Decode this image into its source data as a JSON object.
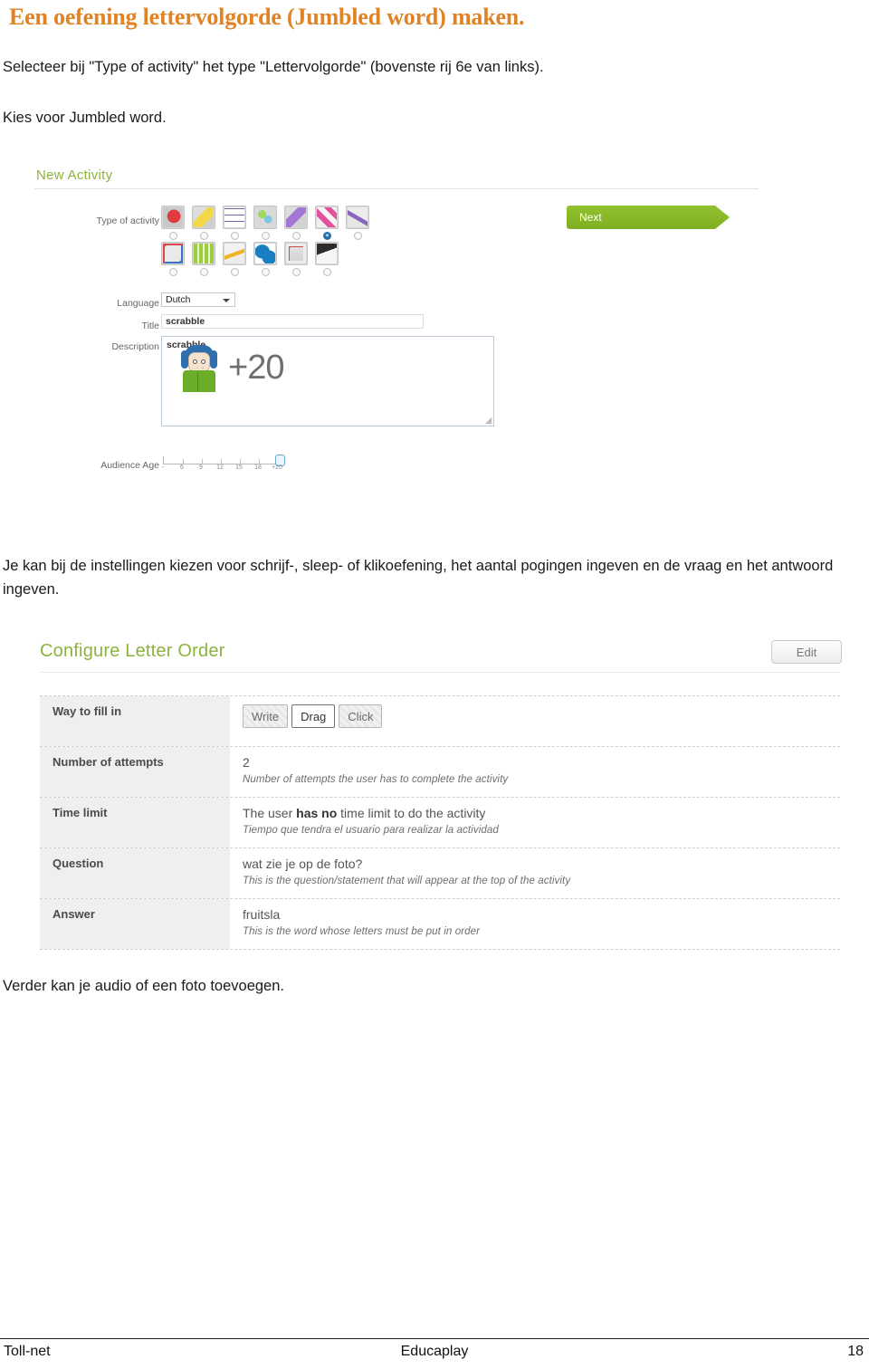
{
  "document": {
    "title": "Een oefening lettervolgorde (Jumbled word) maken.",
    "paragraph_1": "Selecteer bij \"Type of activity\" het type \"Lettervolgorde\" (bovenste rij 6e van links).",
    "paragraph_2": "Kies voor Jumbled word.",
    "paragraph_3": "Je kan bij de instellingen kiezen voor schrijf-, sleep- of klikoefening, het aantal pogingen ingeven en de vraag en het antwoord ingeven.",
    "paragraph_4": "Verder kan je audio of een foto toevoegen.",
    "heading_color": "#E08324"
  },
  "screenshot_new_activity": {
    "panel_title": "New Activity",
    "panel_title_color": "#8cb43c",
    "next_button": "Next",
    "next_button_color": "#8cc22e",
    "labels": {
      "type_of_activity": "Type of activity",
      "language": "Language",
      "title": "Title",
      "description": "Description",
      "audience_age": "Audience Age"
    },
    "activity_icons_row1": [
      {
        "name": "question-icon",
        "colors": [
          "#c9c9c9",
          "#d8262b"
        ]
      },
      {
        "name": "yellow-ruler-icon",
        "colors": [
          "#d6d6d6",
          "#efd23a"
        ]
      },
      {
        "name": "crossword-grid-icon",
        "colors": [
          "#efefef",
          "#7b5fb0"
        ]
      },
      {
        "name": "green-pins-icon",
        "colors": [
          "#d9d9d9",
          "#8fd14f"
        ]
      },
      {
        "name": "purple-feather-icon",
        "colors": [
          "#dcdcdc",
          "#9a6fd1"
        ]
      },
      {
        "name": "pink-letter-tiles-icon",
        "colors": [
          "#ececec",
          "#e3509e"
        ]
      },
      {
        "name": "word-search-icon",
        "colors": [
          "#e3e3e3",
          "#8a66c0"
        ]
      }
    ],
    "activity_icons_row2": [
      {
        "name": "matching-letters-icon",
        "colors": [
          "#dedede",
          "#d94b4b"
        ]
      },
      {
        "name": "green-keyboard-icon",
        "colors": [
          "#d7d7d7",
          "#9bcf3c"
        ]
      },
      {
        "name": "fill-in-blanks-icon",
        "colors": [
          "#e8e8e8",
          "#f0b429"
        ]
      },
      {
        "name": "world-map-icon",
        "colors": [
          "#ffffff",
          "#1a7fc1"
        ]
      },
      {
        "name": "slideshow-icon",
        "colors": [
          "#dcdcdc",
          "#c7504a"
        ]
      },
      {
        "name": "video-clapper-icon",
        "colors": [
          "#e0e0e0",
          "#2c2c2c"
        ]
      }
    ],
    "selected_icon_index": 5,
    "selected_icon_row": 1,
    "language_value": "Dutch",
    "title_value": "scrabble",
    "description_value": "scrabble",
    "age_ticks": [
      "-",
      "6",
      "9",
      "12",
      "15",
      "18",
      "+20"
    ],
    "age_selected_value": "+20"
  },
  "screenshot_configure": {
    "panel_title": "Configure Letter Order",
    "panel_title_color": "#8cb43c",
    "edit_button": "Edit",
    "rows": [
      {
        "key": "Way to fill in",
        "type": "buttons",
        "buttons": [
          "Write",
          "Drag",
          "Click"
        ],
        "selected_button": "Drag",
        "main": "",
        "sub": ""
      },
      {
        "key": "Number of attempts",
        "type": "text",
        "main": "2",
        "sub": "Number of attempts the user has to complete the activity"
      },
      {
        "key": "Time limit",
        "type": "rich",
        "main_prefix": "The user ",
        "main_bold": "has no",
        "main_suffix": " time limit to do the activity",
        "sub": "Tiempo que tendra el usuario para realizar la actividad"
      },
      {
        "key": "Question",
        "type": "text",
        "main": "wat zie je op de foto?",
        "sub": "This is the question/statement that will appear at the top of the activity"
      },
      {
        "key": "Answer",
        "type": "text",
        "main": "fruitsla",
        "sub": "This is the word whose letters must be put in order"
      }
    ]
  },
  "footer": {
    "left": "Toll-net",
    "center": "Educaplay",
    "right": "18"
  }
}
